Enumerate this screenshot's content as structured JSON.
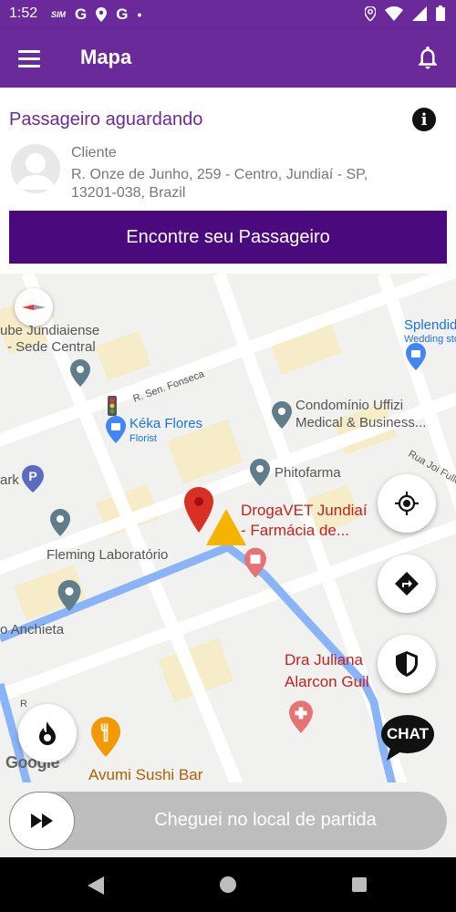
{
  "status_bar": {
    "time": "1:52",
    "left_icons": [
      "sim-icon",
      "google-icon",
      "location-icon",
      "google-icon",
      "dot-icon"
    ],
    "right_icons": [
      "location-icon",
      "wifi-icon",
      "signal-icon",
      "battery-icon"
    ],
    "sim_label": "SIM",
    "g_label": "G",
    "dot": "•"
  },
  "app_bar": {
    "title": "Mapa",
    "color": "#6a2a9a"
  },
  "card": {
    "title": "Passageiro aguardando",
    "info_glyph": "i",
    "client_name": "Cliente",
    "client_address": "R. Onze de Junho, 259 - Centro, Jundiaí - SP, 13201-038, Brazil",
    "button_label": "Encontre seu Passageiro",
    "button_color": "#4a0a7d"
  },
  "map": {
    "labels": {
      "clube": "ube Jundiaiense",
      "clube_sub": "- Sede Central",
      "street_fonseca": "R. Sen. Fonseca",
      "keka": "Kéka Flores",
      "keka_sub": "Florist",
      "uffizi": "Condomínio Uffizi",
      "uffizi_sub": "Medical & Business...",
      "splendida": "Splendida",
      "splendida_sub": "Wedding sto",
      "street_joi": "Rua Joi Fuller",
      "park": "ark",
      "phitofarma": "Phitofarma",
      "drogavet": "DrogaVET Jundiaí",
      "drogavet_sub": "- Farmácia de...",
      "fleming": "Fleming Laboratório",
      "anchieta": "o Anchieta",
      "juliana": "Dra Juliana",
      "juliana_sub": "Alarcon Guil",
      "sushi": "Avumi Sushi Bar",
      "street_r": "R"
    },
    "google_logo": "Google",
    "chat_label": "CHAT",
    "route_color": "#8ab4f8"
  },
  "slider": {
    "label": "Cheguei no local de partida"
  },
  "nav_bar": {
    "icons": [
      "back-icon",
      "home-icon",
      "recent-apps-icon"
    ]
  }
}
